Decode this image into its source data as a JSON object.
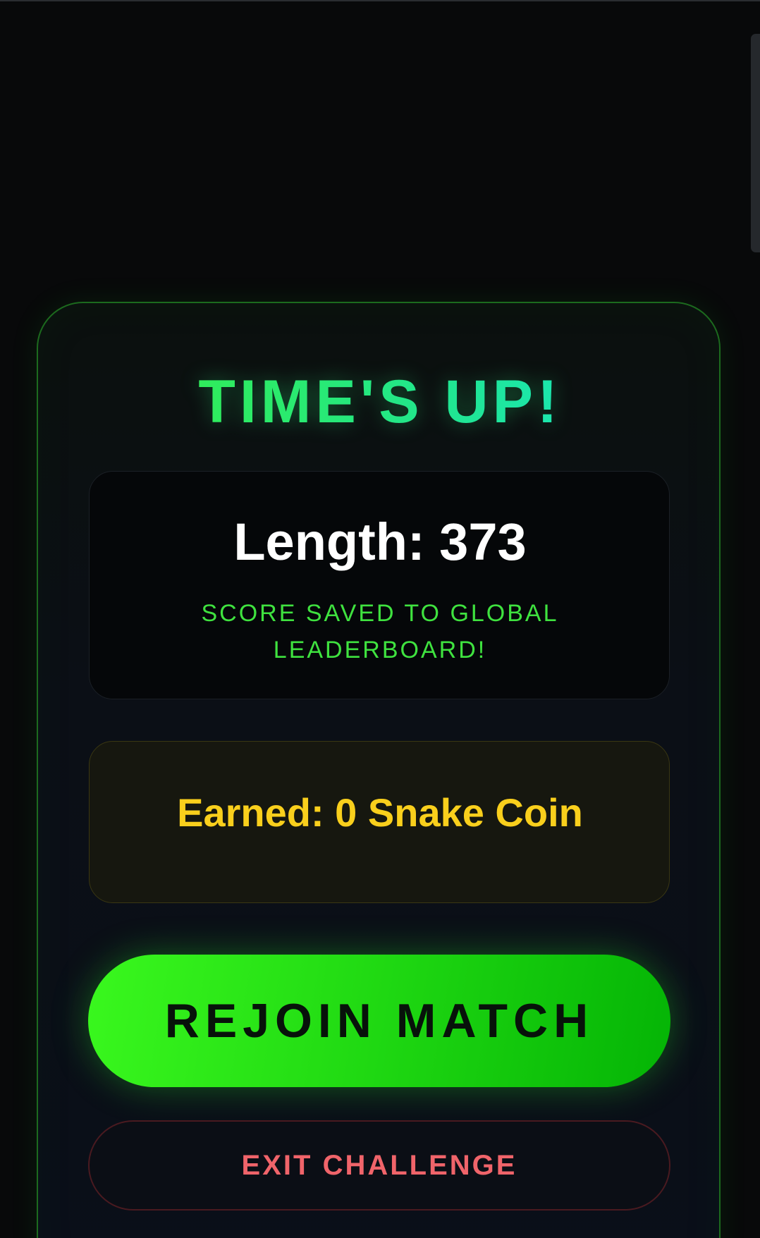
{
  "game_over": {
    "title": "TIME'S UP!",
    "score_text": "Length: 373",
    "saved_message_line1": "SCORE SAVED TO GLOBAL",
    "saved_message_line2": "LEADERBOARD!",
    "earned_text": "Earned: 0 Snake Coin",
    "rejoin_label": "REJOIN MATCH",
    "exit_label": "EXIT CHALLENGE"
  },
  "colors": {
    "background": "#08090a",
    "title_gradient_start": "#3cf232",
    "title_gradient_end": "#11e6e0",
    "saved_message": "#3fe23f",
    "coin_text": "#f9cf1c",
    "rejoin_button": "#22dc14",
    "exit_text": "#f0646a"
  }
}
